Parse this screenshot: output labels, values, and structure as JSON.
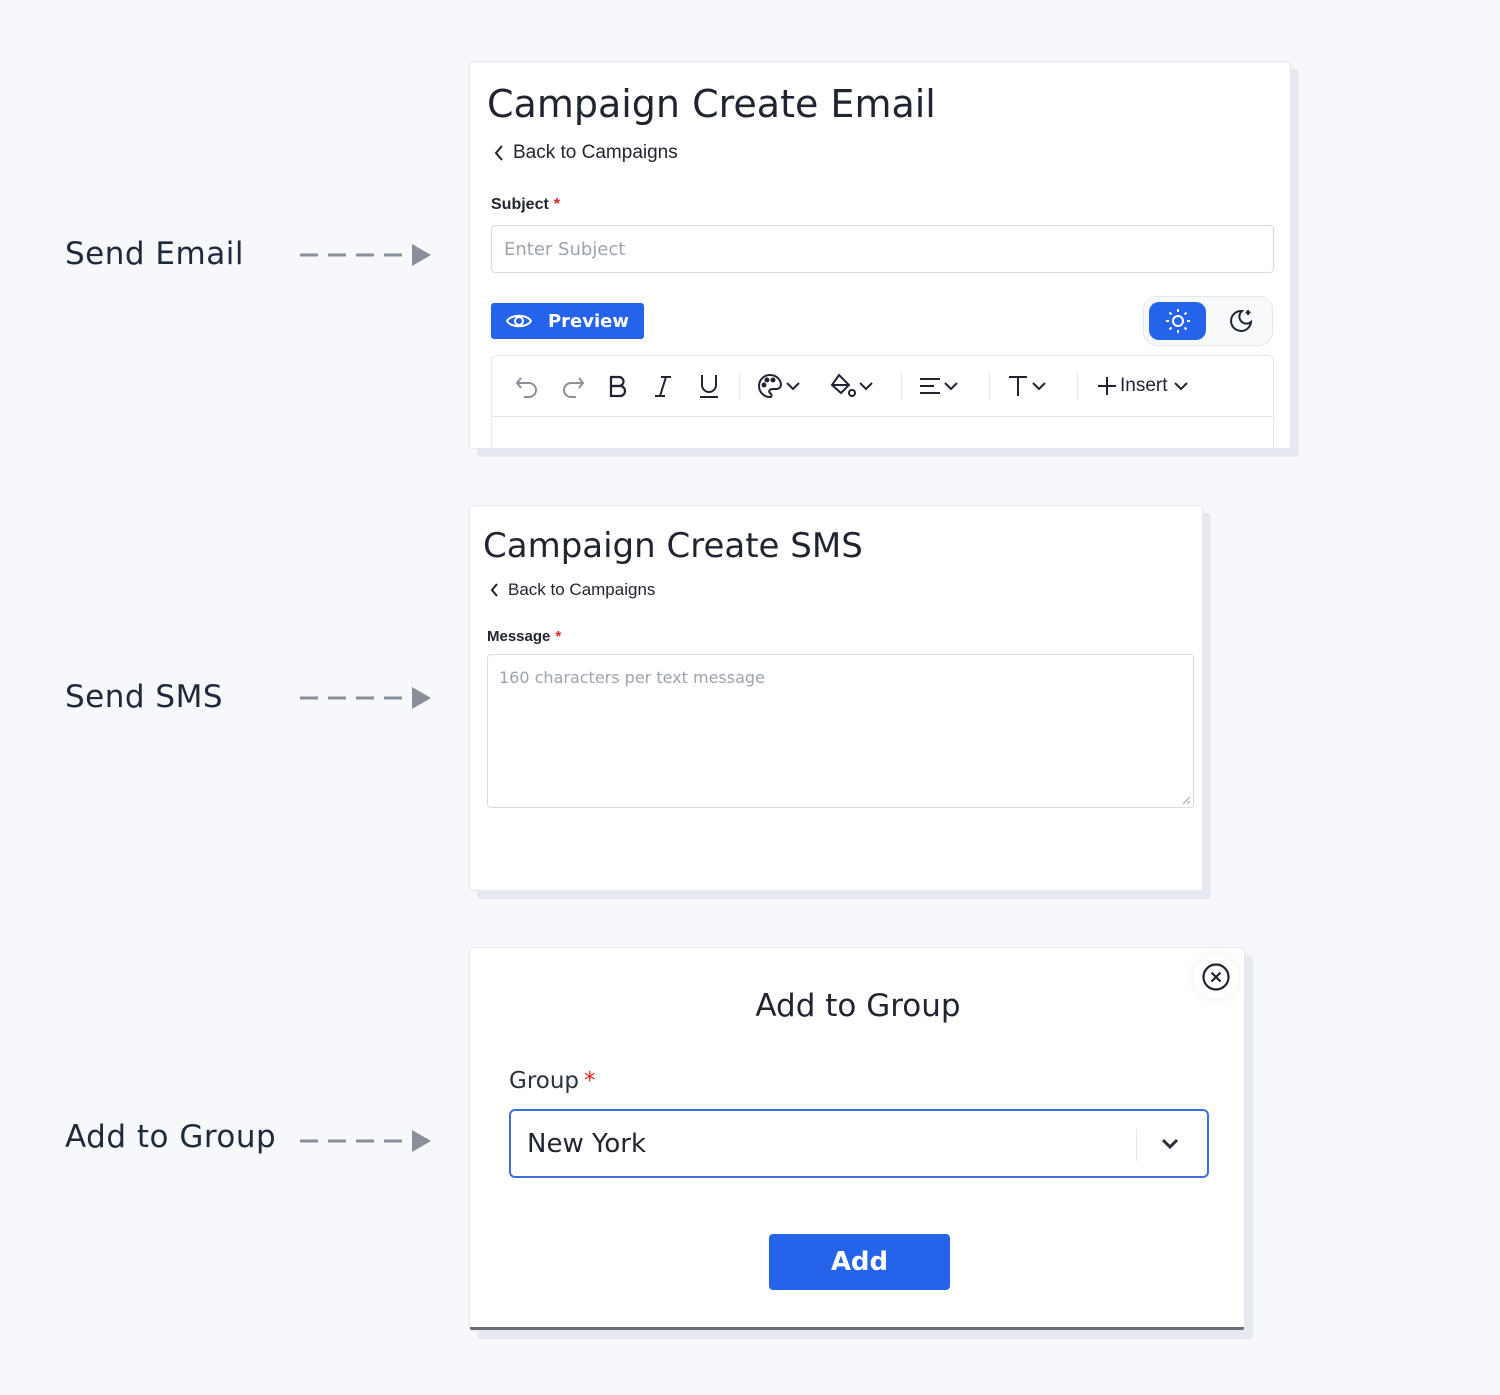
{
  "rows": {
    "email_label": "Send Email",
    "sms_label": "Send SMS",
    "group_label": "Add to Group"
  },
  "email_card": {
    "title": "Campaign Create Email",
    "back_link": "Back to Campaigns",
    "subject_label": "Subject",
    "required_mark": "*",
    "subject_placeholder": "Enter Subject",
    "preview_label": "Preview",
    "theme_active": "light",
    "toolbar": {
      "insert_label": "Insert",
      "icons": [
        "undo-icon",
        "redo-icon",
        "bold-icon",
        "italic-icon",
        "underline-icon",
        "palette-icon",
        "fill-icon",
        "align-icon",
        "text-format-icon",
        "plus-icon"
      ]
    }
  },
  "sms_card": {
    "title": "Campaign Create SMS",
    "back_link": "Back to Campaigns",
    "message_label": "Message",
    "required_mark": "*",
    "message_placeholder": "160 characters per text message"
  },
  "group_card": {
    "title": "Add to Group",
    "group_label": "Group",
    "required_mark": "*",
    "selected_group": "New York",
    "add_label": "Add"
  },
  "colors": {
    "accent": "#2563eb",
    "required": "#e02424",
    "background": "#f7f8fb"
  }
}
